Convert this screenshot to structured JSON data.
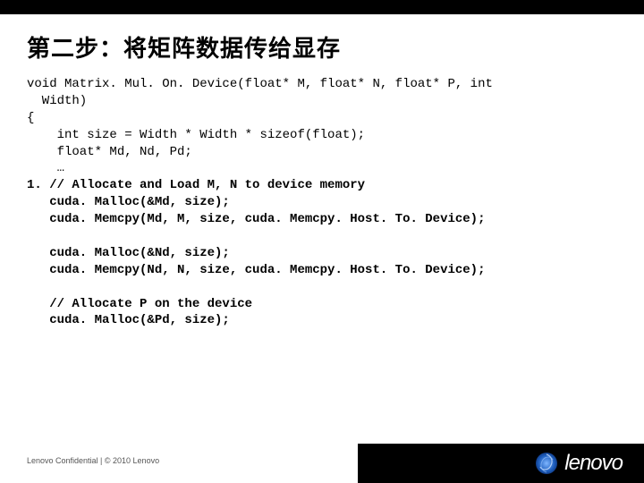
{
  "title": "第二步：将矩阵数据传给显存",
  "code": {
    "l01": "void Matrix. Mul. On. Device(float* M, float* N, float* P, int",
    "l02": "  Width)",
    "l03": "{",
    "l04": "    int size = Width * Width * sizeof(float);",
    "l05": "    float* Md, Nd, Pd;",
    "l06": "    …",
    "l07": "1. // Allocate and Load M, N to device memory",
    "l08": "   cuda. Malloc(&Md, size);",
    "l09": "   cuda. Memcpy(Md, M, size, cuda. Memcpy. Host. To. Device);",
    "l10": "",
    "l11": "   cuda. Malloc(&Nd, size);",
    "l12": "   cuda. Memcpy(Nd, N, size, cuda. Memcpy. Host. To. Device);",
    "l13": "",
    "l14": "   // Allocate P on the device",
    "l15": "   cuda. Malloc(&Pd, size);"
  },
  "footer": {
    "confidential": "Lenovo Confidential | © 2010 Lenovo",
    "brand": "lenovo"
  }
}
